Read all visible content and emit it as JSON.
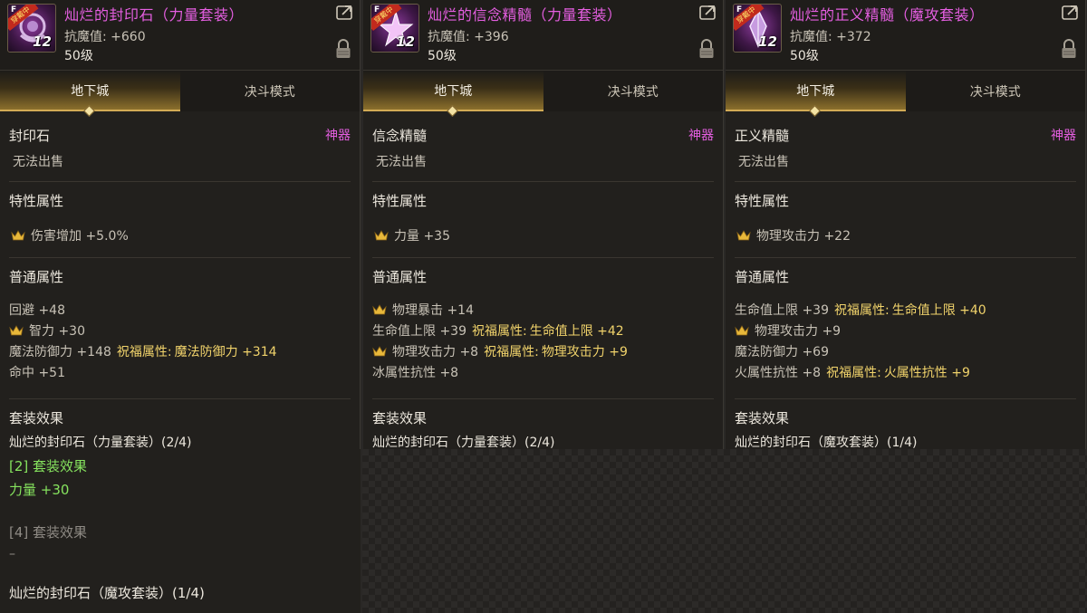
{
  "panels": [
    {
      "title": "灿烂的封印石（力量套装）",
      "magic_resist": "抗魔值: +660",
      "level": "50级",
      "tabs": [
        "地下城",
        "决斗模式"
      ],
      "item_type": "封印石",
      "rarity": "神器",
      "unsellable": "无法出售",
      "trait_header": "特性属性",
      "trait": "伤害增加 +5.0%",
      "normal_header": "普通属性",
      "normal": [
        {
          "text": "回避 +48",
          "crown": false,
          "bless_k": "",
          "bless_v": ""
        },
        {
          "text": "智力 +30",
          "crown": true,
          "bless_k": "",
          "bless_v": ""
        },
        {
          "text": "魔法防御力 +148",
          "crown": false,
          "bless_k": "祝福属性:",
          "bless_v": "魔法防御力 +314"
        },
        {
          "text": "命中 +51",
          "crown": false,
          "bless_k": "",
          "bless_v": ""
        }
      ],
      "set_header": "套装效果",
      "set_line": "灿烂的封印石（力量套装）(2/4)",
      "set2_header": "[2] 套装效果",
      "set2_value": "力量 +30",
      "set4_header": "[4] 套装效果",
      "set4_value": "–",
      "set_line_b": "灿烂的封印石（魔攻套装）(1/4)",
      "equipped_badge": "穿戴中"
    },
    {
      "title": "灿烂的信念精髓（力量套装）",
      "magic_resist": "抗魔值: +396",
      "level": "50级",
      "tabs": [
        "地下城",
        "决斗模式"
      ],
      "item_type": "信念精髓",
      "rarity": "神器",
      "unsellable": "无法出售",
      "trait_header": "特性属性",
      "trait": "力量 +35",
      "normal_header": "普通属性",
      "normal": [
        {
          "text": "物理暴击 +14",
          "crown": true,
          "bless_k": "",
          "bless_v": ""
        },
        {
          "text": "生命值上限 +39",
          "crown": false,
          "bless_k": "祝福属性:",
          "bless_v": "生命值上限 +42"
        },
        {
          "text": "物理攻击力 +8",
          "crown": true,
          "bless_k": "祝福属性:",
          "bless_v": "物理攻击力 +9"
        },
        {
          "text": "冰属性抗性 +8",
          "crown": false,
          "bless_k": "",
          "bless_v": ""
        }
      ],
      "set_header": "套装效果",
      "set_line": "灿烂的封印石（力量套装）(2/4)",
      "equipped_badge": "穿戴中"
    },
    {
      "title": "灿烂的正义精髓（魔攻套装）",
      "magic_resist": "抗魔值: +372",
      "level": "50级",
      "tabs": [
        "地下城",
        "决斗模式"
      ],
      "item_type": "正义精髓",
      "rarity": "神器",
      "unsellable": "无法出售",
      "trait_header": "特性属性",
      "trait": "物理攻击力 +22",
      "normal_header": "普通属性",
      "normal": [
        {
          "text": "生命值上限 +39",
          "crown": false,
          "bless_k": "祝福属性:",
          "bless_v": "生命值上限 +40"
        },
        {
          "text": "物理攻击力 +9",
          "crown": true,
          "bless_k": "",
          "bless_v": ""
        },
        {
          "text": "魔法防御力 +69",
          "crown": false,
          "bless_k": "",
          "bless_v": ""
        },
        {
          "text": "火属性抗性 +8",
          "crown": false,
          "bless_k": "祝福属性:",
          "bless_v": "火属性抗性 +9"
        }
      ],
      "set_header": "套装效果",
      "set_line": "灿烂的封印石（魔攻套装）(1/4)",
      "equipped_badge": "穿戴中"
    }
  ],
  "icon_level": "12",
  "icon_grade": "F",
  "colors": {
    "title": "#e45ee0",
    "bless": "#f1d36b",
    "green": "#86e35e",
    "tab_gold": "#d2ab55"
  }
}
